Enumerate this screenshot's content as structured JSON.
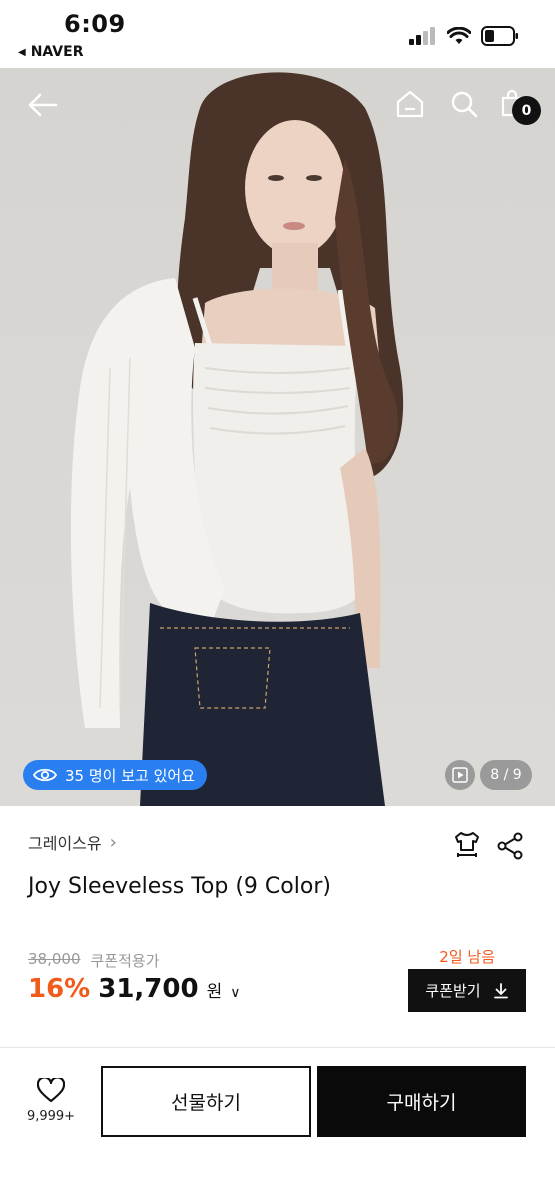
{
  "status_bar": {
    "time": "6:09",
    "back_app": "NAVER",
    "battery_level": 0.3
  },
  "header": {
    "cart_count": "0"
  },
  "hero": {
    "viewers_text": "35 명이 보고 있어요",
    "image_counter": "8 / 9",
    "accent_color": "#2a7ff0"
  },
  "product": {
    "brand": "그레이스유",
    "title": "Joy Sleeveless Top (9 Color)",
    "original_price": "38,000",
    "coupon_price_label": "쿠폰적용가",
    "discount": "16%",
    "price": "31,700",
    "currency": "원",
    "days_left": "2일 남음",
    "coupon_button": "쿠폰받기",
    "discount_color": "#f05a1a"
  },
  "bottom_bar": {
    "like_count": "9,999+",
    "gift_button": "선물하기",
    "buy_button": "구매하기"
  }
}
